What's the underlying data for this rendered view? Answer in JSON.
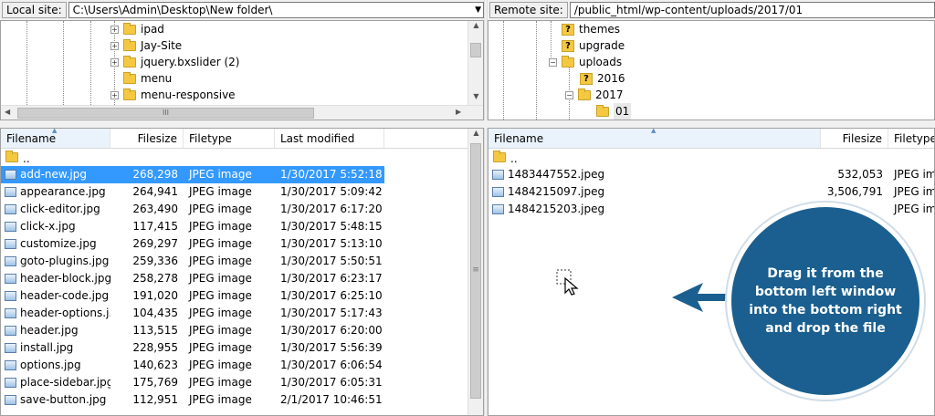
{
  "local": {
    "label": "Local site:",
    "path": "C:\\Users\\Admin\\Desktop\\New folder\\",
    "tree": [
      "ipad",
      "Jay-Site",
      "jquery.bxslider (2)",
      "menu",
      "menu-responsive"
    ],
    "columns": [
      "Filename",
      "Filesize",
      "Filetype",
      "Last modified"
    ],
    "parent": "..",
    "files": [
      {
        "name": "add-new.jpg",
        "size": "268,298",
        "type": "JPEG image",
        "modified": "1/30/2017 5:52:18 ..."
      },
      {
        "name": "appearance.jpg",
        "size": "264,941",
        "type": "JPEG image",
        "modified": "1/30/2017 5:09:42 ..."
      },
      {
        "name": "click-editor.jpg",
        "size": "263,490",
        "type": "JPEG image",
        "modified": "1/30/2017 6:17:20 ..."
      },
      {
        "name": "click-x.jpg",
        "size": "117,415",
        "type": "JPEG image",
        "modified": "1/30/2017 5:48:15 ..."
      },
      {
        "name": "customize.jpg",
        "size": "269,297",
        "type": "JPEG image",
        "modified": "1/30/2017 5:13:10 ..."
      },
      {
        "name": "goto-plugins.jpg",
        "size": "259,336",
        "type": "JPEG image",
        "modified": "1/30/2017 5:50:51 ..."
      },
      {
        "name": "header-block.jpg",
        "size": "258,278",
        "type": "JPEG image",
        "modified": "1/30/2017 6:23:17 ..."
      },
      {
        "name": "header-code.jpg",
        "size": "191,020",
        "type": "JPEG image",
        "modified": "1/30/2017 6:25:10 ..."
      },
      {
        "name": "header-options.j...",
        "size": "104,435",
        "type": "JPEG image",
        "modified": "1/30/2017 5:17:43 ..."
      },
      {
        "name": "header.jpg",
        "size": "113,515",
        "type": "JPEG image",
        "modified": "1/30/2017 6:20:00 ..."
      },
      {
        "name": "install.jpg",
        "size": "228,955",
        "type": "JPEG image",
        "modified": "1/30/2017 5:56:39 ..."
      },
      {
        "name": "options.jpg",
        "size": "140,623",
        "type": "JPEG image",
        "modified": "1/30/2017 6:06:54 ..."
      },
      {
        "name": "place-sidebar.jpg",
        "size": "175,769",
        "type": "JPEG image",
        "modified": "1/30/2017 6:05:31 ..."
      },
      {
        "name": "save-button.jpg",
        "size": "112,951",
        "type": "JPEG image",
        "modified": "2/1/2017 10:46:51 ..."
      }
    ]
  },
  "remote": {
    "label": "Remote site:",
    "path": "/public_html/wp-content/uploads/2017/01",
    "tree": [
      "themes",
      "upgrade",
      "uploads",
      "2016",
      "2017",
      "01"
    ],
    "columns": [
      "Filename",
      "Filesize",
      "Filetype"
    ],
    "parent": "..",
    "files": [
      {
        "name": "1483447552.jpeg",
        "size": "532,053",
        "type": "JPEG ima"
      },
      {
        "name": "1484215097.jpeg",
        "size": "3,506,791",
        "type": "JPEG ima"
      },
      {
        "name": "1484215203.jpeg",
        "size": "",
        "type": "JPEG ima"
      }
    ]
  },
  "callout": {
    "text": "Drag it from the bottom left window into the bottom right and drop the file",
    "color": "#1a5f8f"
  },
  "scroll_h_glyph": "III",
  "scroll_v_glyph": "≡"
}
